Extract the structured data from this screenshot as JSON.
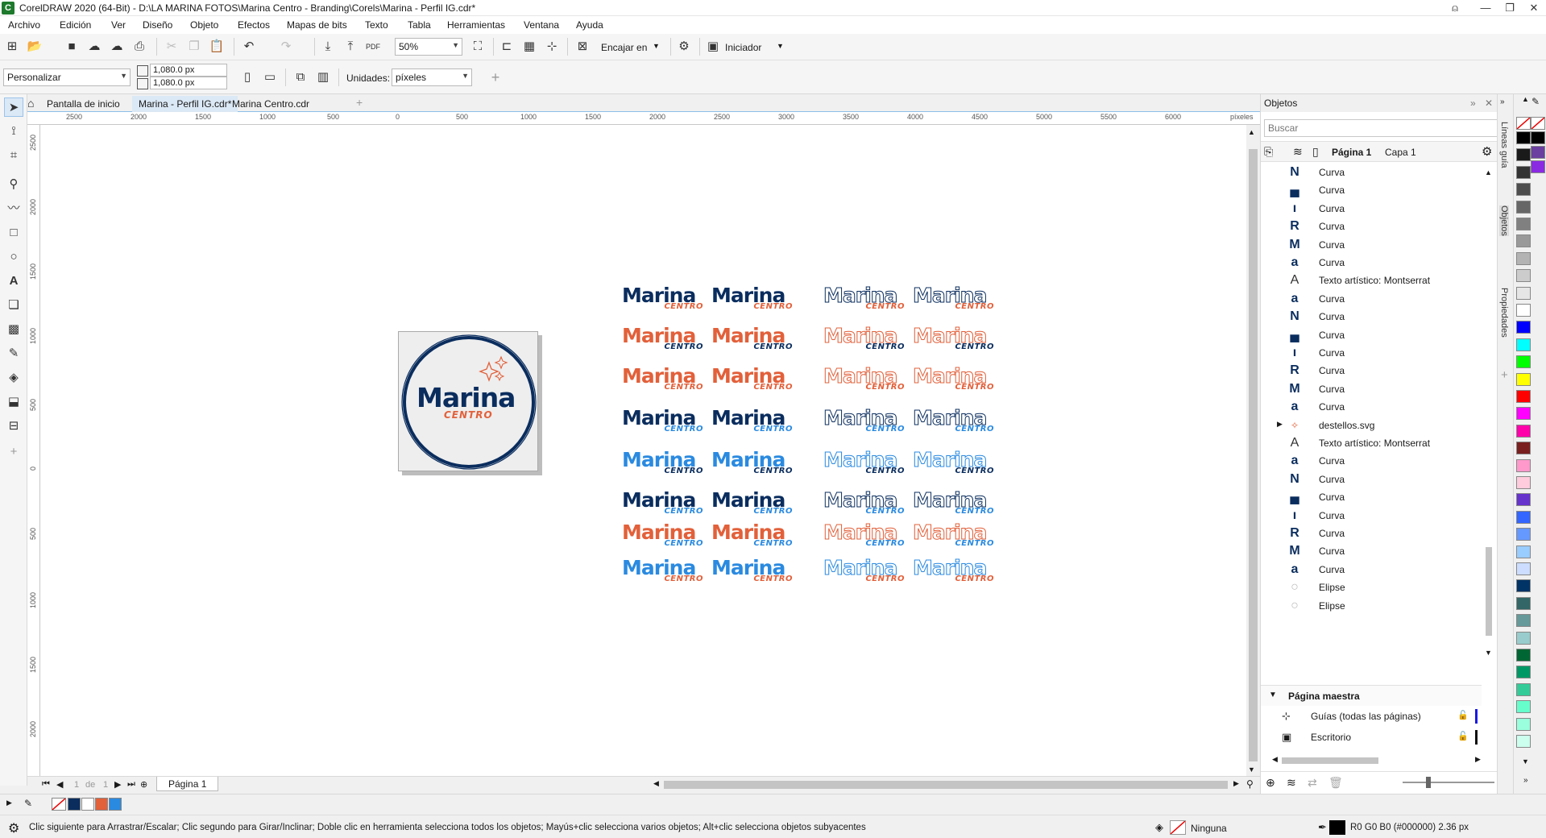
{
  "window": {
    "title": "CorelDRAW 2020 (64-Bit) - D:\\LA MARINA FOTOS\\Marina Centro - Branding\\Corels\\Marina - Perfil IG.cdr*",
    "app_icon": "coreldraw-icon",
    "minimize": "—",
    "restore": "❐",
    "close": "✕"
  },
  "menu": [
    "Archivo",
    "Edición",
    "Ver",
    "Diseño",
    "Objeto",
    "Efectos",
    "Mapas de bits",
    "Texto",
    "Tabla",
    "Herramientas",
    "Ventana",
    "Ayuda"
  ],
  "toolbar": {
    "zoom_value": "50%",
    "snap_label": "Encajar en",
    "launcher_label": "Iniciador"
  },
  "propbar": {
    "preset_value": "Personalizar",
    "width_value": "1,080.0 px",
    "height_value": "1,080.0 px",
    "units_label": "Unidades:",
    "units_value": "píxeles"
  },
  "doc_tabs": {
    "home": "Pantalla de inicio",
    "active": "Marina - Perfil IG.cdr*",
    "other": "Marina Centro.cdr",
    "add": "+"
  },
  "ruler": {
    "unit": "píxeles",
    "h_labels": [
      "2500",
      "2000",
      "1500",
      "1000",
      "500",
      "0",
      "500",
      "1000",
      "1500",
      "2000",
      "2500",
      "3000",
      "3500",
      "4000",
      "4500",
      "5000",
      "5500",
      "6000"
    ],
    "v_labels": [
      "2500",
      "2000",
      "1500",
      "1000",
      "500",
      "0",
      "500",
      "1000",
      "1500",
      "2000"
    ]
  },
  "artboard": {
    "brand": "Marina",
    "sub": "CENTRO"
  },
  "logos": {
    "word": "Marina",
    "sub": "CENTRO",
    "colors": {
      "navy": "#0a2d5e",
      "orange": "#e2603a",
      "blue": "#2a8ae0"
    }
  },
  "page_nav": {
    "current": "1",
    "of": "de",
    "total": "1",
    "page_tab": "Página 1"
  },
  "objects_panel": {
    "title": "Objetos",
    "search_placeholder": "Buscar",
    "page_label": "Página 1",
    "layer_label": "Capa 1",
    "items": [
      {
        "glyph": "N",
        "label": "Curva"
      },
      {
        "glyph": "▄",
        "label": "Curva"
      },
      {
        "glyph": "ı",
        "label": "Curva"
      },
      {
        "glyph": "R",
        "label": "Curva"
      },
      {
        "glyph": "M",
        "label": "Curva"
      },
      {
        "glyph": "a",
        "label": "Curva"
      },
      {
        "glyph": "A",
        "label": "Texto artístico: Montserrat"
      },
      {
        "glyph": "a",
        "label": "Curva"
      },
      {
        "glyph": "N",
        "label": "Curva"
      },
      {
        "glyph": "▄",
        "label": "Curva"
      },
      {
        "glyph": "ı",
        "label": "Curva"
      },
      {
        "glyph": "R",
        "label": "Curva"
      },
      {
        "glyph": "M",
        "label": "Curva"
      },
      {
        "glyph": "a",
        "label": "Curva"
      },
      {
        "glyph": "✧",
        "label": "destellos.svg"
      },
      {
        "glyph": "A",
        "label": "Texto artístico: Montserrat"
      },
      {
        "glyph": "a",
        "label": "Curva"
      },
      {
        "glyph": "N",
        "label": "Curva"
      },
      {
        "glyph": "▄",
        "label": "Curva"
      },
      {
        "glyph": "ı",
        "label": "Curva"
      },
      {
        "glyph": "R",
        "label": "Curva"
      },
      {
        "glyph": "M",
        "label": "Curva"
      },
      {
        "glyph": "a",
        "label": "Curva"
      },
      {
        "glyph": "○",
        "label": "Elipse"
      },
      {
        "glyph": "○",
        "label": "Elipse"
      }
    ],
    "master_label": "Página maestra",
    "master_items": [
      "Guías (todas las páginas)",
      "Escritorio"
    ]
  },
  "docker_tabs": [
    "Líneas guía",
    "Objetos",
    "Propiedades"
  ],
  "palette": [
    "#000000",
    "#1a1a1a",
    "#333333",
    "#4d4d4d",
    "#666666",
    "#808080",
    "#999999",
    "#b3b3b3",
    "#cccccc",
    "#e6e6e6",
    "#ffffff",
    "#0000ff",
    "#00ffff",
    "#00ff00",
    "#ffff00",
    "#ff0000",
    "#ff00ff",
    "#ff00aa",
    "#7a1f1f",
    "#ff99cc",
    "#ffccdd",
    "#6633cc",
    "#3366ff",
    "#6699ff",
    "#99ccff",
    "#ccddff",
    "#003366",
    "#336666",
    "#669999",
    "#99cccc",
    "#006633",
    "#009966",
    "#33cc99",
    "#66ffcc",
    "#99ffdd",
    "#ccffee"
  ],
  "palette_right": [
    "#000000",
    "#6b3fa0",
    "#8a2be2"
  ],
  "document_palette": [
    "#0a2d5e",
    "#ffffff",
    "#e2603a",
    "#2a8ae0"
  ],
  "status": {
    "hint": "Clic siguiente para Arrastrar/Escalar; Clic segundo para Girar/Inclinar; Doble clic en herramienta selecciona todos los objetos; Mayús+clic selecciona varios objetos; Alt+clic selecciona objetos subyacentes",
    "fill_label": "Ninguna",
    "outline_label": "R0 G0 B0 (#000000)  2.36 px"
  }
}
